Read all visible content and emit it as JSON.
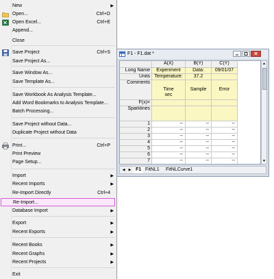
{
  "menu": {
    "items": [
      {
        "label": "New",
        "shortcut": "",
        "submenu": true,
        "icon": ""
      },
      {
        "label": "Open...",
        "shortcut": "Ctrl+O",
        "submenu": false,
        "icon": "open-folder-icon"
      },
      {
        "label": "Open Excel...",
        "shortcut": "Ctrl+E",
        "submenu": false,
        "icon": "excel-icon"
      },
      {
        "label": "Append...",
        "shortcut": "",
        "submenu": false,
        "icon": ""
      },
      {
        "label": "Close",
        "shortcut": "",
        "submenu": false,
        "icon": ""
      },
      {
        "label": "Save Project",
        "shortcut": "Ctrl+S",
        "submenu": false,
        "icon": "save-icon"
      },
      {
        "label": "Save Project As...",
        "shortcut": "",
        "submenu": false,
        "icon": ""
      },
      {
        "label": "Save Window As...",
        "shortcut": "",
        "submenu": false,
        "icon": ""
      },
      {
        "label": "Save Template As...",
        "shortcut": "",
        "submenu": false,
        "icon": ""
      },
      {
        "label": "Save Workbook As Analysis Template...",
        "shortcut": "",
        "submenu": false,
        "icon": ""
      },
      {
        "label": "Add Word Bookmarks to Analysis Template...",
        "shortcut": "",
        "submenu": false,
        "icon": ""
      },
      {
        "label": "Batch Processing...",
        "shortcut": "",
        "submenu": false,
        "icon": ""
      },
      {
        "label": "Save Project without Data...",
        "shortcut": "",
        "submenu": false,
        "icon": ""
      },
      {
        "label": "Duplicate Project without Data",
        "shortcut": "",
        "submenu": false,
        "icon": ""
      },
      {
        "label": "Print...",
        "shortcut": "Ctrl+P",
        "submenu": false,
        "icon": "printer-icon"
      },
      {
        "label": "Print Preview",
        "shortcut": "",
        "submenu": false,
        "icon": ""
      },
      {
        "label": "Page Setup...",
        "shortcut": "",
        "submenu": false,
        "icon": ""
      },
      {
        "label": "Import",
        "shortcut": "",
        "submenu": true,
        "icon": ""
      },
      {
        "label": "Recent Imports",
        "shortcut": "",
        "submenu": true,
        "icon": ""
      },
      {
        "label": "Re-Import Directly",
        "shortcut": "Ctrl+4",
        "submenu": false,
        "icon": ""
      },
      {
        "label": "Re-Import...",
        "shortcut": "",
        "submenu": false,
        "icon": "",
        "highlighted": true
      },
      {
        "label": "Database Import",
        "shortcut": "",
        "submenu": true,
        "icon": ""
      },
      {
        "label": "Export",
        "shortcut": "",
        "submenu": true,
        "icon": ""
      },
      {
        "label": "Recent Exports",
        "shortcut": "",
        "submenu": true,
        "icon": ""
      },
      {
        "label": "Recent Books",
        "shortcut": "",
        "submenu": true,
        "icon": ""
      },
      {
        "label": "Recent Graphs",
        "shortcut": "",
        "submenu": true,
        "icon": ""
      },
      {
        "label": "Recent Projects",
        "shortcut": "",
        "submenu": true,
        "icon": ""
      },
      {
        "label": "Exit",
        "shortcut": "",
        "submenu": false,
        "icon": ""
      }
    ]
  },
  "workbook": {
    "title": "F1 - F1.dat *",
    "columns": [
      "A(X)",
      "B(Y)",
      "C(Y)"
    ],
    "row_labels": [
      "Long Name",
      "Units",
      "Comments",
      "F(x)=",
      "Sparklines"
    ],
    "long_name": [
      "Experiment",
      "Data:",
      "09/01/07"
    ],
    "units": [
      "Temperature:",
      "37.2",
      ""
    ],
    "comments": [
      "Time\nsec",
      "Sample",
      "Error"
    ],
    "row_numbers": [
      "1",
      "2",
      "3",
      "4",
      "5",
      "6",
      "7"
    ],
    "empty_value": "--",
    "tabs": [
      "F1",
      "FitNL1",
      "FitNLCurve1"
    ]
  }
}
